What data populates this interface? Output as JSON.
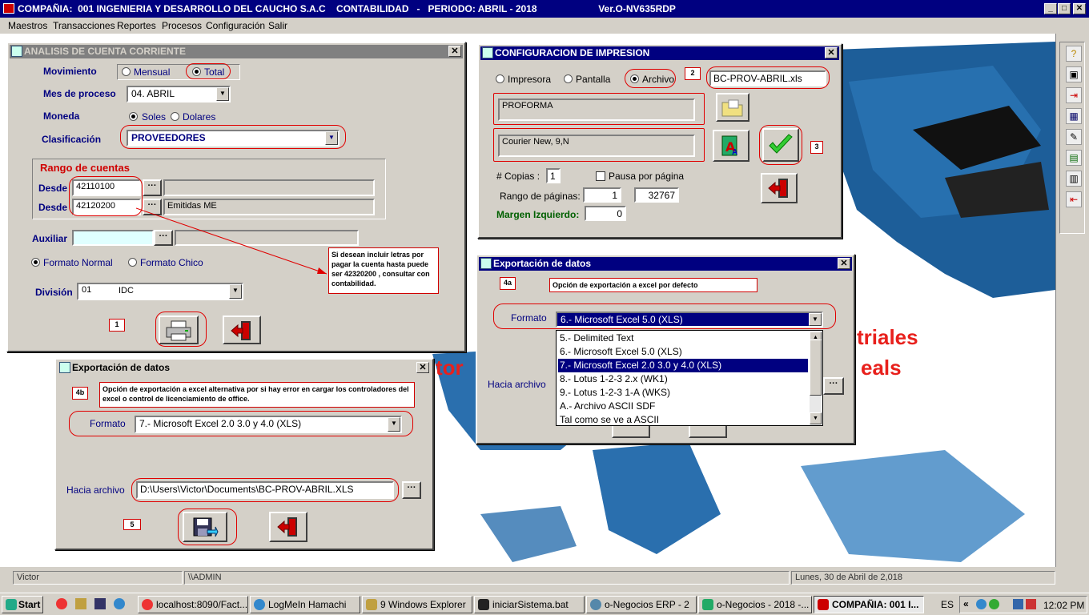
{
  "app": {
    "title": "COMPAÑIA:  001 INGENIERIA Y DESARROLLO DEL CAUCHO S.A.C    CONTABILIDAD   -   PERIODO: ABRIL - 2018                       Ver.O-NV635RDP",
    "menu": [
      "Maestros",
      "Transacciones",
      "Reportes",
      "Procesos",
      "Configuración",
      "Salir"
    ]
  },
  "bg_text": {
    "line1": "e",
    "line2": "triales",
    "line3": "tor",
    "line4": "eals"
  },
  "analisis": {
    "title": "ANALISIS DE CUENTA CORRIENTE",
    "movimiento_label": "Movimiento",
    "mensual": "Mensual",
    "total": "Total",
    "mes_label": "Mes de proceso",
    "mes_value": "04. ABRIL",
    "moneda_label": "Moneda",
    "soles": "Soles",
    "dolares": "Dolares",
    "clasif_label": "Clasificación",
    "clasif_value": "PROVEEDORES",
    "rango_label": "Rango de cuentas",
    "desde_label": "Desde",
    "desde1": "42110100",
    "desde2": "42120200",
    "desc2": "Emitidas ME",
    "auxiliar_label": "Auxiliar",
    "formato_normal": "Formato Normal",
    "formato_chico": "Formato Chico",
    "division_label": "División",
    "division_code": "01",
    "division_name": "IDC",
    "tag": "1",
    "note": "Si desean incluir letras por pagar la cuenta hasta puede ser  42320200 , consultar con contabilidad."
  },
  "config": {
    "title": "CONFIGURACION DE IMPRESION",
    "impresora": "Impresora",
    "pantalla": "Pantalla",
    "archivo": "Archivo",
    "tag2": "2",
    "file_value": "BC-PROV-ABRIL.xls",
    "proforma": "PROFORMA",
    "font_value": "Courier New, 9,N",
    "tag3": "3",
    "copias_label": "# Copias :",
    "copias_value": "1",
    "pausa": "Pausa por página",
    "rango_label": "Rango de páginas:",
    "rango_from": "1",
    "rango_to": "32767",
    "margen_label": "Margen Izquierdo:",
    "margen_value": "0"
  },
  "export_a": {
    "title": "Exportación de datos",
    "tag": "4a",
    "note": "Opción de exportación a excel por defecto",
    "formato_label": "Formato",
    "formato_value": "6.- Microsoft Excel 5.0 (XLS)",
    "options": [
      "5.- Delimited Text",
      "6.- Microsoft Excel 5.0 (XLS)",
      "7.- Microsoft Excel 2.0 3.0 y 4.0 (XLS)",
      "8.- Lotus 1-2-3 2.x (WK1)",
      "9.- Lotus 1-2-3 1-A (WKS)",
      "A.- Archivo ASCII SDF",
      "Tal como se ve a ASCII"
    ],
    "hacia_label": "Hacia archivo"
  },
  "export_b": {
    "title": "Exportación de datos",
    "tag": "4b",
    "note": "Opción de exportación a excel alternativa por si hay error en cargar los controladores del excel o control de licenciamiento de office.",
    "formato_label": "Formato",
    "formato_value": "7.- Microsoft Excel 2.0 3.0 y 4.0 (XLS)",
    "hacia_label": "Hacia archivo",
    "hacia_value": "D:\\Users\\Victor\\Documents\\BC-PROV-ABRIL.XLS",
    "tag5": "5"
  },
  "status": {
    "user": "Victor",
    "path": "\\\\ADMIN",
    "date": "Lunes, 30 de Abril de 2,018"
  },
  "taskbar": {
    "start": "Start",
    "items": [
      "localhost:8090/Fact...",
      "LogMeIn Hamachi",
      "9 Windows Explorer",
      "iniciarSistema.bat",
      "o-Negocios ERP - 2",
      "o-Negocios - 2018 -...",
      "COMPAÑIA:  001 I..."
    ],
    "lang": "ES",
    "clock": "12:02 PM"
  },
  "colors": {
    "title_active": "#000080",
    "highlight": "#e00000",
    "bg_red_text": "#e8201c"
  }
}
